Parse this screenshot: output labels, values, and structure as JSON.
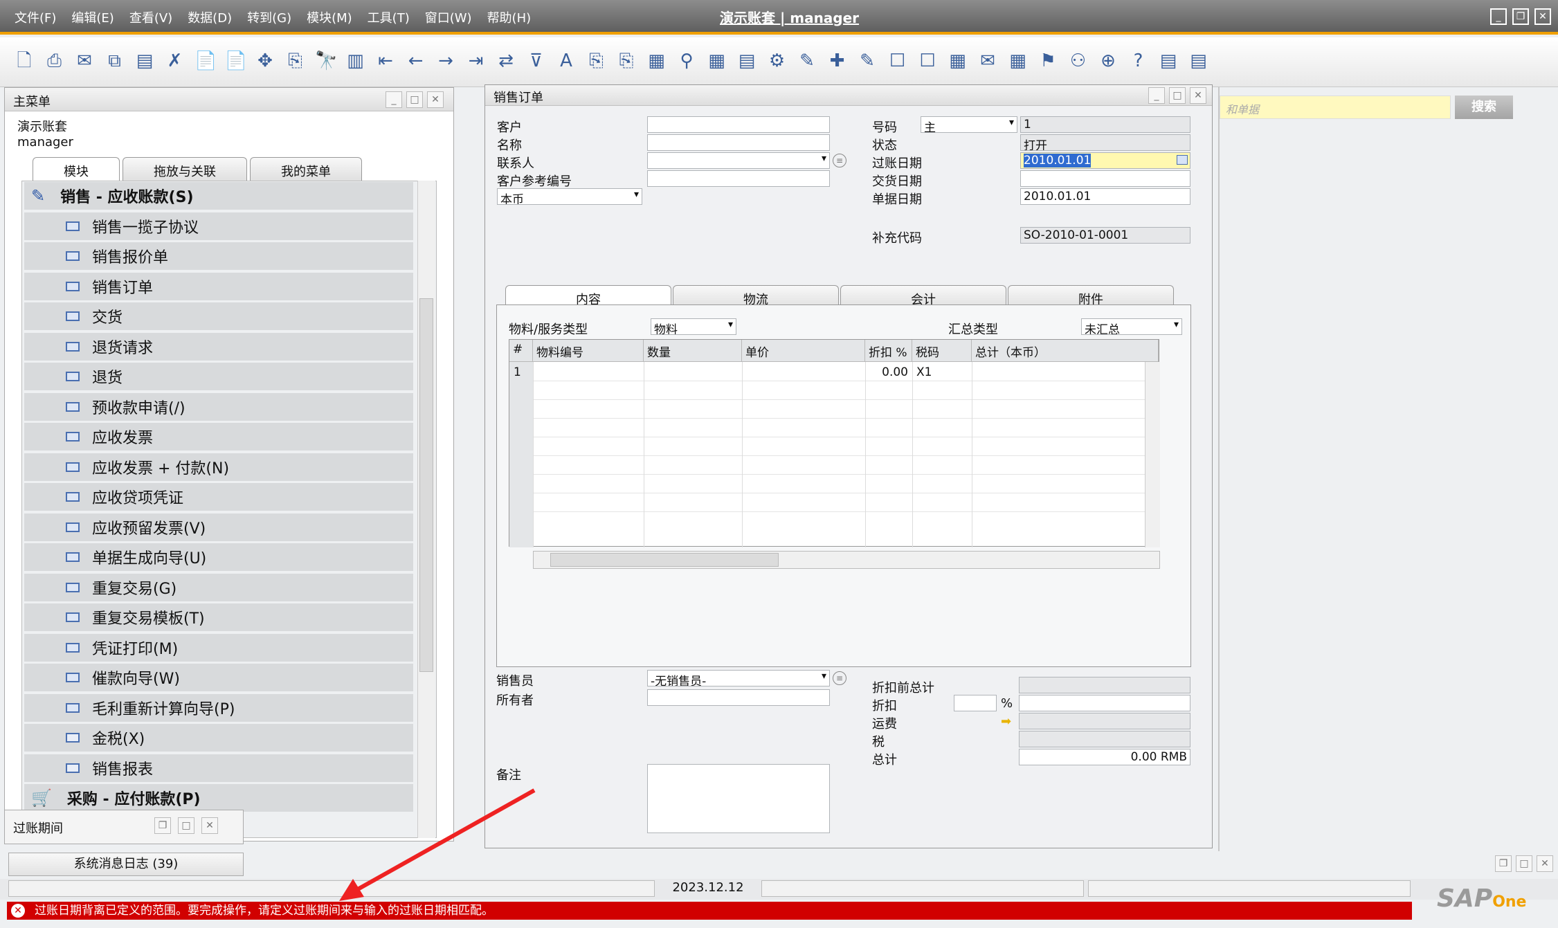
{
  "menubar": [
    "文件(F)",
    "编辑(E)",
    "查看(V)",
    "数据(D)",
    "转到(G)",
    "模块(M)",
    "工具(T)",
    "窗口(W)",
    "帮助(H)"
  ],
  "app_title": "演示账套 | manager",
  "main_menu": {
    "title": "主菜单",
    "company": "演示账套",
    "user": "manager",
    "tabs": [
      "模块",
      "拖放与关联",
      "我的菜单"
    ],
    "items": [
      {
        "label": "销售 - 应收账款(S)",
        "type": "category"
      },
      {
        "label": "销售一揽子协议",
        "type": "form"
      },
      {
        "label": "销售报价单",
        "type": "form"
      },
      {
        "label": "销售订单",
        "type": "form"
      },
      {
        "label": "交货",
        "type": "form"
      },
      {
        "label": "退货请求",
        "type": "form"
      },
      {
        "label": "退货",
        "type": "form"
      },
      {
        "label": "预收款申请(/)",
        "type": "form"
      },
      {
        "label": "应收发票",
        "type": "form"
      },
      {
        "label": "应收发票 + 付款(N)",
        "type": "form"
      },
      {
        "label": "应收贷项凭证",
        "type": "form"
      },
      {
        "label": "应收预留发票(V)",
        "type": "form"
      },
      {
        "label": "单据生成向导(U)",
        "type": "form"
      },
      {
        "label": "重复交易(G)",
        "type": "form"
      },
      {
        "label": "重复交易模板(T)",
        "type": "form"
      },
      {
        "label": "凭证打印(M)",
        "type": "form"
      },
      {
        "label": "催款向导(W)",
        "type": "form"
      },
      {
        "label": "毛利重新计算向导(P)",
        "type": "form"
      },
      {
        "label": "金税(X)",
        "type": "folder"
      },
      {
        "label": "销售报表",
        "type": "folder"
      },
      {
        "label": "采购 - 应付账款(P)",
        "type": "category"
      }
    ]
  },
  "posting_period_window": "过账期间",
  "sales_order": {
    "title": "销售订单",
    "labels": {
      "customer": "客户",
      "name": "名称",
      "contact": "联系人",
      "cust_ref": "客户参考编号",
      "currency": "本币",
      "number": "号码",
      "status": "状态",
      "posting_date": "过账日期",
      "delivery_date": "交货日期",
      "doc_date": "单据日期",
      "addl_code": "补充代码"
    },
    "values": {
      "series": "主",
      "number": "1",
      "status": "打开",
      "posting_date": "2010.01.01",
      "delivery_date": "",
      "doc_date": "2010.01.01",
      "addl_code": "SO-2010-01-0001"
    },
    "tabs": [
      "内容",
      "物流",
      "会计",
      "附件"
    ],
    "item_type_label": "物料/服务类型",
    "item_type": "物料",
    "summary_label": "汇总类型",
    "summary": "未汇总",
    "grid_headers": [
      "#",
      "物料编号",
      "数量",
      "单价",
      "折扣 %",
      "税码",
      "总计（本币）"
    ],
    "grid_row": [
      "1",
      "",
      "",
      "",
      "0.00",
      "X1",
      ""
    ],
    "salesperson_label": "销售员",
    "salesperson": "-无销售员-",
    "owner_label": "所有者",
    "remarks_label": "备注",
    "totals": {
      "before_disc": "折扣前总计",
      "discount": "折扣",
      "percent": "%",
      "freight": "运费",
      "tax": "税",
      "total": "总计",
      "total_value": "0.00 RMB"
    }
  },
  "search": {
    "placeholder": "和单据",
    "button": "搜索"
  },
  "message_log": "系统消息日志 (39)",
  "status_date": "2023.12.12",
  "error_message": "过账日期背离已定义的范围。要完成操作，请定义过账期间来与输入的过账日期相匹配。",
  "brand": "SAP"
}
